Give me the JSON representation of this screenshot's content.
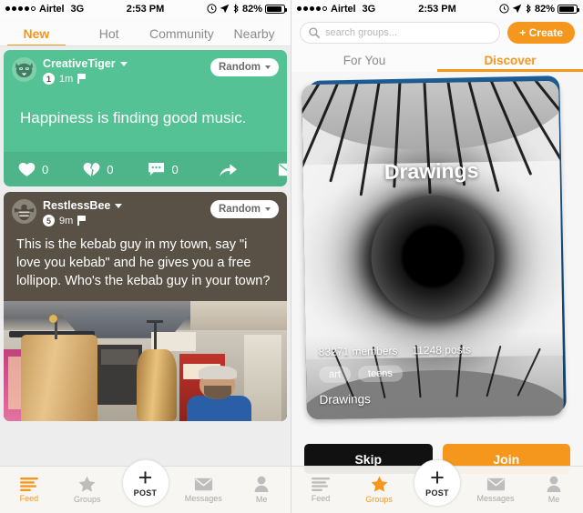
{
  "status_bar": {
    "carrier": "Airtel",
    "network": "3G",
    "time": "2:53 PM",
    "battery": "82%",
    "signal_dots_filled": 4,
    "signal_dots_total": 5
  },
  "left_screen": {
    "tabs": [
      {
        "label": "New",
        "active": true
      },
      {
        "label": "Hot",
        "active": false
      },
      {
        "label": "Community",
        "active": false
      },
      {
        "label": "Nearby",
        "active": false
      }
    ],
    "posts": [
      {
        "username": "CreativeTiger",
        "avatar_icon": "tiger-avatar",
        "badge": "1",
        "time": "1m",
        "flag_icon": "flag-icon",
        "channel": "Random",
        "text": "Happiness is finding good music.",
        "color": "#54c294",
        "actions": {
          "like_count": "0",
          "dislike_count": "0",
          "comment_count": "0",
          "share_icon": "share-arrow-icon",
          "message_icon": "envelope-icon"
        }
      },
      {
        "username": "RestlessBee",
        "avatar_icon": "bee-avatar",
        "badge": "5",
        "time": "9m",
        "flag_icon": "flag-icon",
        "channel": "Random",
        "text": "This is the kebab guy in my town, say \"i love you kebab\" and he gives you a free lollipop. Who's the kebab guy in your town?",
        "color": "#5a5146",
        "photo_alt": "kebab-shop-photo"
      }
    ],
    "bottom_nav": [
      {
        "label": "Feed",
        "icon": "feed-icon",
        "active": true
      },
      {
        "label": "Groups",
        "icon": "star-icon",
        "active": false
      },
      {
        "label": "POST",
        "icon": "plus-icon",
        "active": false
      },
      {
        "label": "Messages",
        "icon": "envelope-icon",
        "active": false
      },
      {
        "label": "Me",
        "icon": "person-icon",
        "active": false
      }
    ]
  },
  "right_screen": {
    "search_placeholder": "search groups...",
    "search_value": "",
    "create_label": "+ Create",
    "tabs": [
      {
        "label": "For You",
        "active": false
      },
      {
        "label": "Discover",
        "active": true
      }
    ],
    "group_card": {
      "title_overlay": "Drawings",
      "members": "83271 members",
      "posts": "11248 posts",
      "tags": [
        "art",
        "teens"
      ],
      "name": "Drawings",
      "image_alt": "eye-photo"
    },
    "skip_label": "Skip",
    "join_label": "Join",
    "bottom_nav": [
      {
        "label": "Feed",
        "icon": "feed-icon",
        "active": false
      },
      {
        "label": "Groups",
        "icon": "star-icon",
        "active": true
      },
      {
        "label": "POST",
        "icon": "plus-icon",
        "active": false
      },
      {
        "label": "Messages",
        "icon": "envelope-icon",
        "active": false
      },
      {
        "label": "Me",
        "icon": "person-icon",
        "active": false
      }
    ]
  },
  "colors": {
    "accent": "#f5971d",
    "post_green": "#54c294",
    "post_brown": "#5a5146",
    "inactive_gray": "#a8a8a8"
  }
}
